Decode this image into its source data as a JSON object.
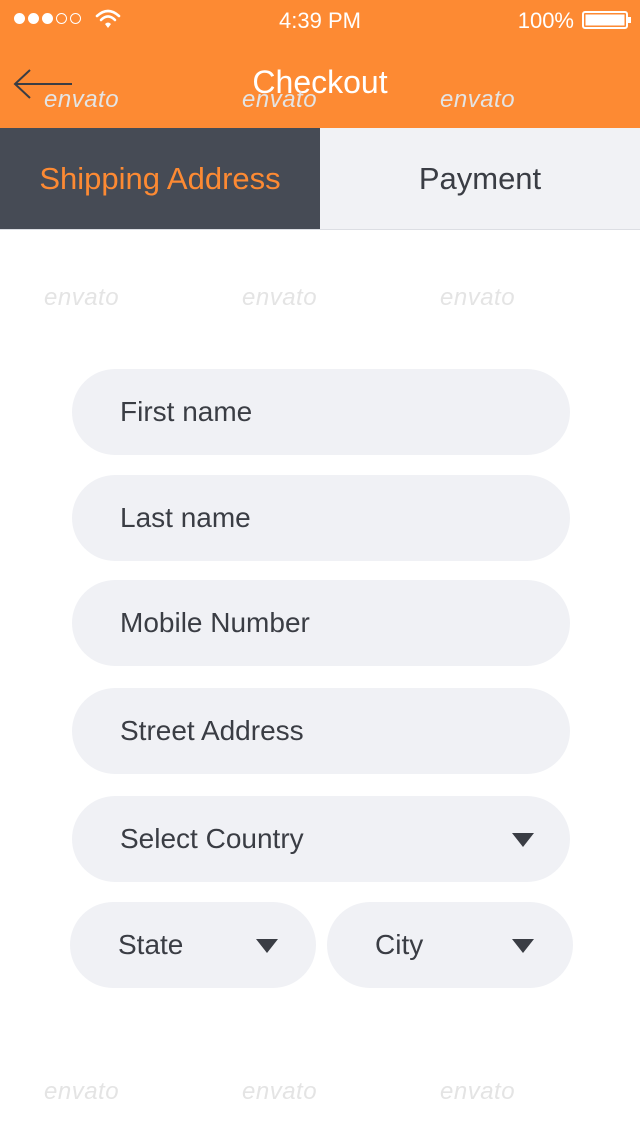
{
  "status_bar": {
    "time": "4:39 PM",
    "battery": "100%",
    "signal_icon": "signal-dots-icon",
    "wifi_icon": "wifi-icon",
    "battery_icon": "battery-icon"
  },
  "header": {
    "title": "Checkout",
    "back_icon": "back-arrow-icon",
    "background_color": "#fd8a33"
  },
  "tabs": [
    {
      "label": "Shipping Address",
      "active": true
    },
    {
      "label": "Payment",
      "active": false
    }
  ],
  "form": {
    "first_name": "First name",
    "last_name": "Last name",
    "mobile_number": "Mobile Number",
    "street_address": "Street Address",
    "country": "Select Country",
    "state": "State",
    "city": "City",
    "dropdown_icon": "caret-down-icon"
  },
  "watermark": "envato",
  "colors": {
    "accent": "#fd8a33",
    "tab_active_bg": "#464b55",
    "field_bg": "#f0f1f5",
    "text": "#3a3d44"
  }
}
